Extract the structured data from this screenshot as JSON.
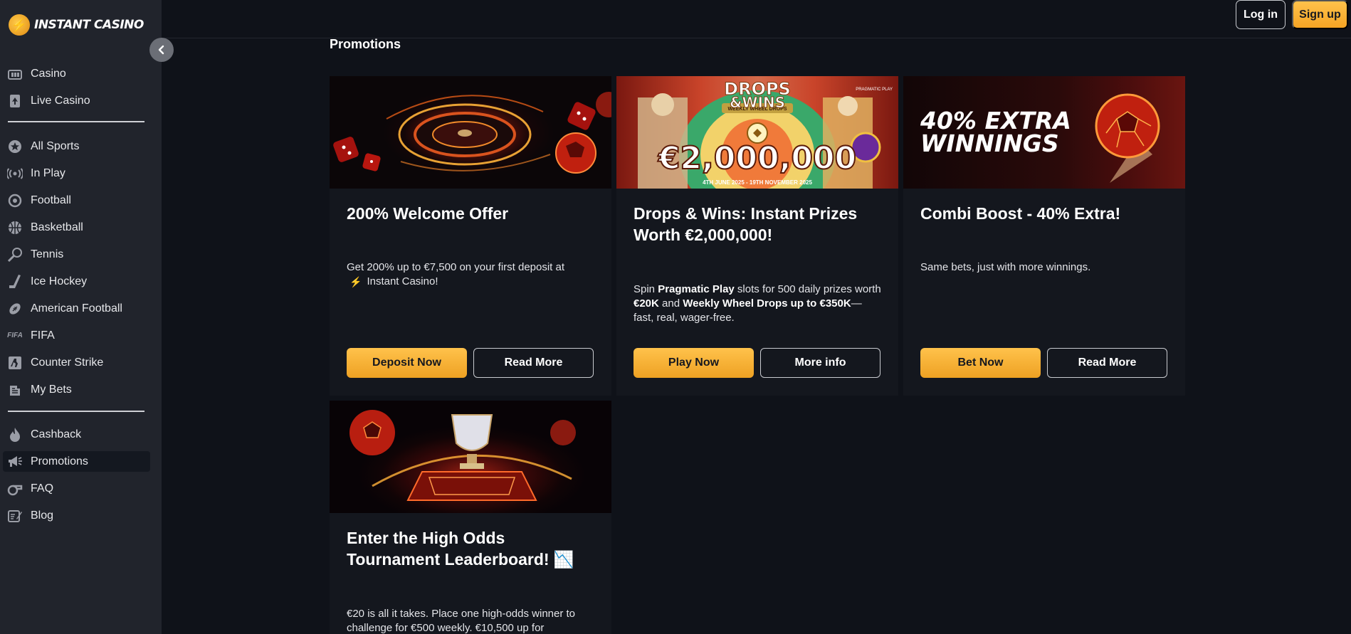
{
  "brand": {
    "name": "INSTANT CASINO"
  },
  "header": {
    "login_label": "Log in",
    "signup_label": "Sign up"
  },
  "page": {
    "title": "Promotions"
  },
  "sidebar": {
    "groups": [
      [
        {
          "label": "Casino",
          "icon": "casino-icon"
        },
        {
          "label": "Live Casino",
          "icon": "spade-card-icon"
        }
      ],
      [
        {
          "label": "All Sports",
          "icon": "star-ball-icon"
        },
        {
          "label": "In Play",
          "icon": "broadcast-icon"
        },
        {
          "label": "Football",
          "icon": "football-icon"
        },
        {
          "label": "Basketball",
          "icon": "basketball-icon"
        },
        {
          "label": "Tennis",
          "icon": "tennis-racket-icon"
        },
        {
          "label": "Ice Hockey",
          "icon": "hockey-stick-icon"
        },
        {
          "label": "American Football",
          "icon": "american-football-icon"
        },
        {
          "label": "FIFA",
          "icon": "fifa-icon"
        },
        {
          "label": "Counter Strike",
          "icon": "counter-strike-icon"
        },
        {
          "label": "My Bets",
          "icon": "ticket-icon"
        }
      ],
      [
        {
          "label": "Cashback",
          "icon": "flame-icon"
        },
        {
          "label": "Promotions",
          "icon": "megaphone-icon",
          "active": true
        },
        {
          "label": "FAQ",
          "icon": "whistle-icon"
        },
        {
          "label": "Blog",
          "icon": "blog-icon"
        }
      ]
    ],
    "fifa_badge": "FIFA"
  },
  "promotions": [
    {
      "banner": {
        "alt": "roulette-dice-art"
      },
      "title": "200% Welcome Offer",
      "text": "Get 200% up to €7,500 on your first deposit at",
      "text2": "Instant Casino!",
      "primary": "Deposit Now",
      "secondary": "Read More"
    },
    {
      "banner": {
        "headline1": "DROPS",
        "headline2": "&WINS",
        "amount": "€2,000,000",
        "dates": "4TH JUNE 2025 - 19TH NOVEMBER 2025",
        "provider": "PRAGMATIC PLAY",
        "badge": "WEEKLY WHEEL DROPS"
      },
      "title": "Drops & Wins: Instant Prizes Worth €2,000,000!",
      "text_parts": [
        "Spin ",
        "Pragmatic Play",
        " slots for 500 daily prizes worth ",
        "€20K",
        " and ",
        "Weekly Wheel Drops up to €350K",
        "—fast, real, wager-free."
      ],
      "primary": "Play Now",
      "secondary": "More info"
    },
    {
      "banner": {
        "headline1": "40% EXTRA",
        "headline2": "WINNINGS"
      },
      "title": "Combi Boost - 40% Extra!",
      "text": "Same bets, just with more winnings.",
      "primary": "Bet Now",
      "secondary": "Read More"
    },
    {
      "banner": {
        "alt": "trophy-pitch-art"
      },
      "title": "Enter the High Odds Tournament Leaderboard! 📉",
      "text": "€20 is all it takes. Place one high-odds winner to challenge for €500 weekly. €10,500 up for"
    }
  ],
  "colors": {
    "accent": "#f7b233",
    "sidebar_bg": "#21242c",
    "page_bg": "#0f1219",
    "card_bg": "#14171e"
  }
}
